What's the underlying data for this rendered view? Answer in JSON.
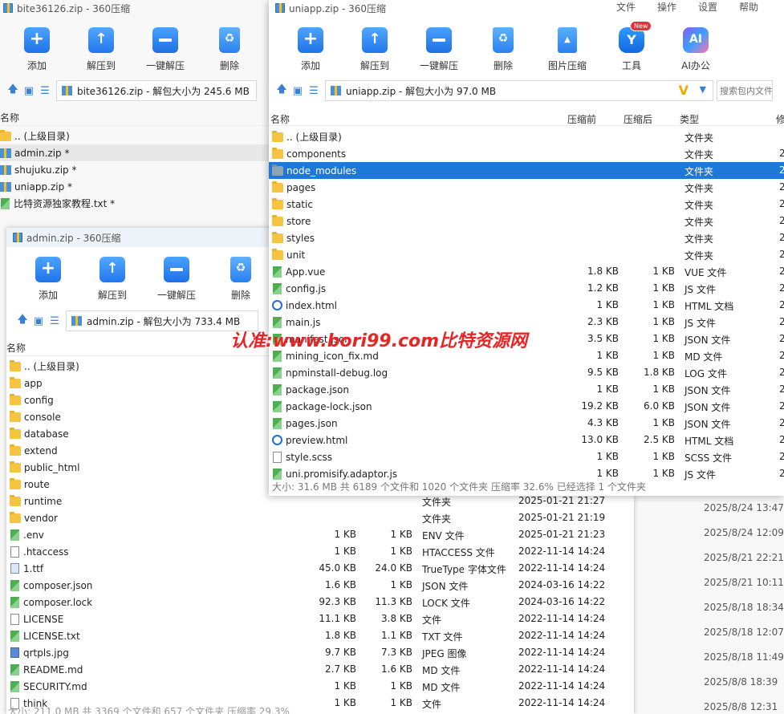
{
  "bg_window": {
    "title": "bite36126.zip - 360压缩",
    "tools": [
      "添加",
      "解压到",
      "一键解压",
      "删除"
    ],
    "address": "bite36126.zip - 解包大小为 245.6 MB",
    "col_name": "名称",
    "items": [
      {
        "name": ".. (上级目录)",
        "icon": "folder"
      },
      {
        "name": "admin.zip *",
        "icon": "zip"
      },
      {
        "name": "shujuku.zip *",
        "icon": "zip"
      },
      {
        "name": "uniapp.zip *",
        "icon": "zip"
      },
      {
        "name": "比特资源独家教程.txt *",
        "icon": "code"
      }
    ],
    "right_dates": [
      "2025/8/24 13:47",
      "2025/8/24 12:09",
      "2025/8/21 22:21",
      "2025/8/21 10:11",
      "2025/8/18 18:34",
      "2025/8/18 12:07",
      "2025/8/18 11:49",
      "2025/8/8 18:39",
      "2025/8/8 12:31"
    ]
  },
  "admin_window": {
    "title": "admin.zip - 360压缩",
    "tools": [
      "添加",
      "解压到",
      "一键解压",
      "删除"
    ],
    "address": "admin.zip - 解包大小为 733.4 MB",
    "col_name": "名称",
    "status": "大小: 211.0 MB 共 3369 个文件和 657 个文件夹 压缩率 29.3%",
    "rows": [
      {
        "name": ".. (上级目录)",
        "icon": "folder",
        "orig": "",
        "comp": "",
        "type": "",
        "date": ""
      },
      {
        "name": "app",
        "icon": "folder",
        "orig": "",
        "comp": "",
        "type": "",
        "date": ""
      },
      {
        "name": "config",
        "icon": "folder",
        "orig": "",
        "comp": "",
        "type": "",
        "date": ""
      },
      {
        "name": "console",
        "icon": "folder",
        "orig": "",
        "comp": "",
        "type": "",
        "date": ""
      },
      {
        "name": "database",
        "icon": "folder",
        "orig": "",
        "comp": "",
        "type": "",
        "date": ""
      },
      {
        "name": "extend",
        "icon": "folder",
        "orig": "",
        "comp": "",
        "type": "",
        "date": ""
      },
      {
        "name": "public_html",
        "icon": "folder",
        "orig": "",
        "comp": "",
        "type": "",
        "date": ""
      },
      {
        "name": "route",
        "icon": "folder",
        "orig": "",
        "comp": "",
        "type": "",
        "date": ""
      },
      {
        "name": "runtime",
        "icon": "folder",
        "orig": "",
        "comp": "",
        "type": "文件夹",
        "date": "2025-01-21 21:27"
      },
      {
        "name": "vendor",
        "icon": "folder",
        "orig": "",
        "comp": "",
        "type": "文件夹",
        "date": "2025-01-21 21:19"
      },
      {
        "name": ".env",
        "icon": "code",
        "orig": "1 KB",
        "comp": "1 KB",
        "type": "ENV 文件",
        "date": "2025-01-21 21:23"
      },
      {
        "name": ".htaccess",
        "icon": "doc",
        "orig": "1 KB",
        "comp": "1 KB",
        "type": "HTACCESS 文件",
        "date": "2022-11-14 14:24"
      },
      {
        "name": "1.ttf",
        "icon": "font",
        "orig": "45.0 KB",
        "comp": "24.0 KB",
        "type": "TrueType 字体文件",
        "date": "2022-11-14 14:24"
      },
      {
        "name": "composer.json",
        "icon": "code",
        "orig": "1.6 KB",
        "comp": "1 KB",
        "type": "JSON 文件",
        "date": "2024-03-16 14:22"
      },
      {
        "name": "composer.lock",
        "icon": "code",
        "orig": "92.3 KB",
        "comp": "11.3 KB",
        "type": "LOCK 文件",
        "date": "2024-03-16 14:22"
      },
      {
        "name": "LICENSE",
        "icon": "doc",
        "orig": "11.1 KB",
        "comp": "3.8 KB",
        "type": "文件",
        "date": "2022-11-14 14:24"
      },
      {
        "name": "LICENSE.txt",
        "icon": "code",
        "orig": "1.8 KB",
        "comp": "1.1 KB",
        "type": "TXT 文件",
        "date": "2022-11-14 14:24"
      },
      {
        "name": "qrtpls.jpg",
        "icon": "img",
        "orig": "9.7 KB",
        "comp": "7.3 KB",
        "type": "JPEG 图像",
        "date": "2022-11-14 14:24"
      },
      {
        "name": "README.md",
        "icon": "code",
        "orig": "2.7 KB",
        "comp": "1.6 KB",
        "type": "MD 文件",
        "date": "2022-11-14 14:24"
      },
      {
        "name": "SECURITY.md",
        "icon": "code",
        "orig": "1 KB",
        "comp": "1 KB",
        "type": "MD 文件",
        "date": "2022-11-14 14:24"
      },
      {
        "name": "think",
        "icon": "doc",
        "orig": "1 KB",
        "comp": "1 KB",
        "type": "文件",
        "date": "2022-11-14 14:24"
      }
    ]
  },
  "uniapp_window": {
    "title": "uniapp.zip - 360压缩",
    "menu": [
      "文件",
      "操作",
      "设置",
      "帮助"
    ],
    "tools": [
      "添加",
      "解压到",
      "一键解压",
      "删除",
      "图片压缩",
      "工具",
      "AI办公"
    ],
    "new_badge": "New",
    "address": "uniapp.zip - 解包大小为 97.0 MB",
    "search_placeholder": "搜索包内文件",
    "headers": {
      "name": "名称",
      "orig": "压缩前",
      "comp": "压缩后",
      "type": "类型",
      "mod": "修"
    },
    "status": "大小: 31.6 MB 共 6189 个文件和 1020 个文件夹 压缩率 32.6% 已经选择 1 个文件夹",
    "rows": [
      {
        "name": ".. (上级目录)",
        "icon": "folder",
        "orig": "",
        "comp": "",
        "type": "文件夹",
        "tail": "",
        "sel": false
      },
      {
        "name": "components",
        "icon": "folder",
        "orig": "",
        "comp": "",
        "type": "文件夹",
        "tail": "2",
        "sel": false
      },
      {
        "name": "node_modules",
        "icon": "folder-grey",
        "orig": "",
        "comp": "",
        "type": "文件夹",
        "tail": "2",
        "sel": true
      },
      {
        "name": "pages",
        "icon": "folder",
        "orig": "",
        "comp": "",
        "type": "文件夹",
        "tail": "2",
        "sel": false
      },
      {
        "name": "static",
        "icon": "folder",
        "orig": "",
        "comp": "",
        "type": "文件夹",
        "tail": "2",
        "sel": false
      },
      {
        "name": "store",
        "icon": "folder",
        "orig": "",
        "comp": "",
        "type": "文件夹",
        "tail": "2",
        "sel": false
      },
      {
        "name": "styles",
        "icon": "folder",
        "orig": "",
        "comp": "",
        "type": "文件夹",
        "tail": "2",
        "sel": false
      },
      {
        "name": "unit",
        "icon": "folder",
        "orig": "",
        "comp": "",
        "type": "文件夹",
        "tail": "2",
        "sel": false
      },
      {
        "name": "App.vue",
        "icon": "code",
        "orig": "1.8 KB",
        "comp": "1 KB",
        "type": "VUE 文件",
        "tail": "2",
        "sel": false
      },
      {
        "name": "config.js",
        "icon": "code",
        "orig": "1.2 KB",
        "comp": "1 KB",
        "type": "JS 文件",
        "tail": "2",
        "sel": false
      },
      {
        "name": "index.html",
        "icon": "html",
        "orig": "1 KB",
        "comp": "1 KB",
        "type": "HTML 文档",
        "tail": "2",
        "sel": false
      },
      {
        "name": "main.js",
        "icon": "code",
        "orig": "2.3 KB",
        "comp": "1 KB",
        "type": "JS 文件",
        "tail": "2",
        "sel": false
      },
      {
        "name": "manifest.json",
        "icon": "code",
        "orig": "3.5 KB",
        "comp": "1 KB",
        "type": "JSON 文件",
        "tail": "2",
        "sel": false
      },
      {
        "name": "mining_icon_fix.md",
        "icon": "code",
        "orig": "1 KB",
        "comp": "1 KB",
        "type": "MD 文件",
        "tail": "2",
        "sel": false
      },
      {
        "name": "npminstall-debug.log",
        "icon": "code",
        "orig": "9.5 KB",
        "comp": "1.8 KB",
        "type": "LOG 文件",
        "tail": "2",
        "sel": false
      },
      {
        "name": "package.json",
        "icon": "code",
        "orig": "1 KB",
        "comp": "1 KB",
        "type": "JSON 文件",
        "tail": "2",
        "sel": false
      },
      {
        "name": "package-lock.json",
        "icon": "code",
        "orig": "19.2 KB",
        "comp": "6.0 KB",
        "type": "JSON 文件",
        "tail": "2",
        "sel": false
      },
      {
        "name": "pages.json",
        "icon": "code",
        "orig": "4.3 KB",
        "comp": "1 KB",
        "type": "JSON 文件",
        "tail": "2",
        "sel": false
      },
      {
        "name": "preview.html",
        "icon": "html",
        "orig": "13.0 KB",
        "comp": "2.5 KB",
        "type": "HTML 文档",
        "tail": "2",
        "sel": false
      },
      {
        "name": "style.scss",
        "icon": "doc",
        "orig": "1 KB",
        "comp": "1 KB",
        "type": "SCSS 文件",
        "tail": "2",
        "sel": false
      },
      {
        "name": "uni.promisify.adaptor.js",
        "icon": "code",
        "orig": "1 KB",
        "comp": "1 KB",
        "type": "JS 文件",
        "tail": "2",
        "sel": false
      }
    ]
  },
  "watermark": "认准:www.bori99.com比特资源网",
  "colors": {
    "selection": "#1e78d7",
    "accent": "#1e73e8",
    "watermark": "#e82424"
  }
}
